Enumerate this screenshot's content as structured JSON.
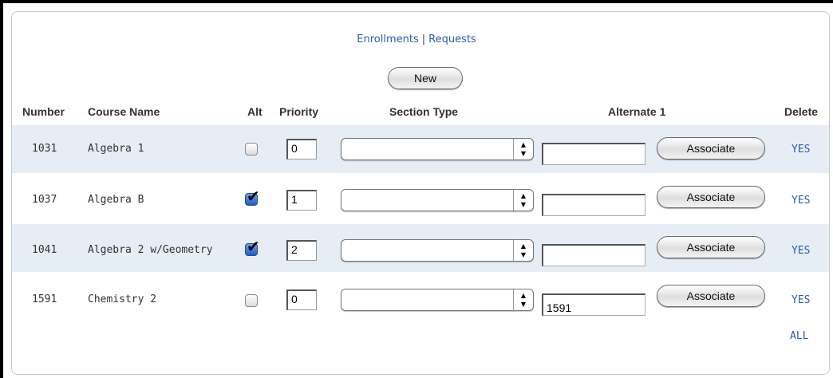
{
  "tabs": {
    "enrollments": "Enrollments",
    "separator": "|",
    "requests": "Requests"
  },
  "new_button": "New",
  "headers": {
    "number": "Number",
    "course_name": "Course Name",
    "alt": "Alt",
    "priority": "Priority",
    "section_type": "Section Type",
    "alternate_1": "Alternate 1",
    "delete": "Delete"
  },
  "rows": [
    {
      "number": "1031",
      "course": "Algebra 1",
      "alt_checked": false,
      "priority": "0",
      "section_type": "",
      "alternate": "",
      "associate": "Associate",
      "delete": "YES"
    },
    {
      "number": "1037",
      "course": "Algebra B",
      "alt_checked": true,
      "priority": "1",
      "section_type": "",
      "alternate": "",
      "associate": "Associate",
      "delete": "YES"
    },
    {
      "number": "1041",
      "course": "Algebra 2 w/Geometry",
      "alt_checked": true,
      "priority": "2",
      "section_type": "",
      "alternate": "",
      "associate": "Associate",
      "delete": "YES"
    },
    {
      "number": "1591",
      "course": "Chemistry 2",
      "alt_checked": false,
      "priority": "0",
      "section_type": "",
      "alternate": "1591",
      "associate": "Associate",
      "delete": "YES"
    }
  ],
  "delete_all": "ALL",
  "colors": {
    "link": "#2b5fa6",
    "row_shade": "#e6edf5",
    "checkbox_on": "#1e5cc0"
  }
}
